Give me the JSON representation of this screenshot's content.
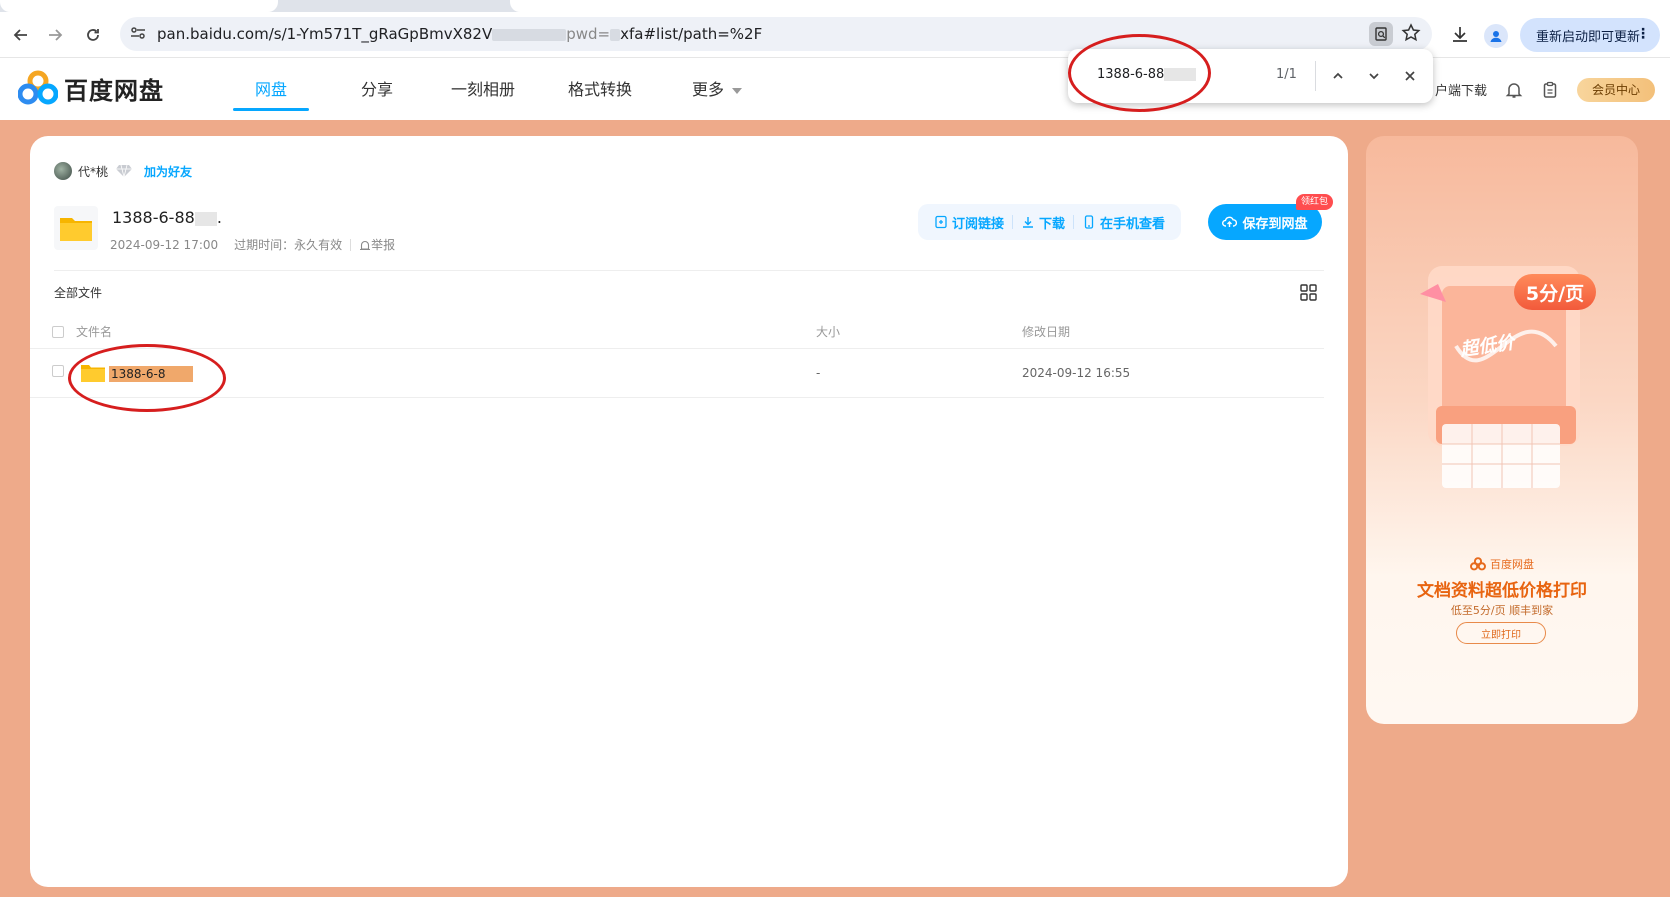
{
  "browser": {
    "url_prefix": "pan.baidu.com/s/1-Ym571T_gRaGpBmvX82V",
    "url_middle": "pwd=",
    "url_suffix": "xfa#list/path=%2F",
    "update_label": "重新启动即可更新"
  },
  "findbar": {
    "query": "1388-6-88",
    "count": "1/1"
  },
  "site": {
    "logo_text": "百度网盘",
    "nav": [
      "网盘",
      "分享",
      "一刻相册",
      "格式转换",
      "更多"
    ],
    "client_download": "户端下载",
    "vip_label": "会员中心"
  },
  "share": {
    "owner_name": "代*桃",
    "add_friend": "加为好友",
    "title": "1388-6-88",
    "title_tail": ".",
    "created": "2024-09-12 17:00",
    "expire": "过期时间：永久有效",
    "report": "举报",
    "actions": {
      "subscribe": "订阅链接",
      "download": "下载",
      "mobile": "在手机查看",
      "save": "保存到网盘",
      "redpack": "领红包"
    }
  },
  "files": {
    "breadcrumb": "全部文件",
    "columns": {
      "name": "文件名",
      "size": "大小",
      "modified": "修改日期"
    },
    "rows": [
      {
        "name": "1388-6-8",
        "size": "-",
        "modified": "2024-09-12 16:55"
      }
    ]
  },
  "ad": {
    "badge": "5分/页",
    "low_price": "超低价",
    "brand": "百度网盘",
    "title": "文档资料超低价格打印",
    "subtitle": "低至5分/页 顺丰到家",
    "button": "立即打印"
  },
  "colors": {
    "brand_blue": "#06a7ff",
    "page_bg": "#eeaa8a",
    "annotation_red": "#d61e1e"
  }
}
